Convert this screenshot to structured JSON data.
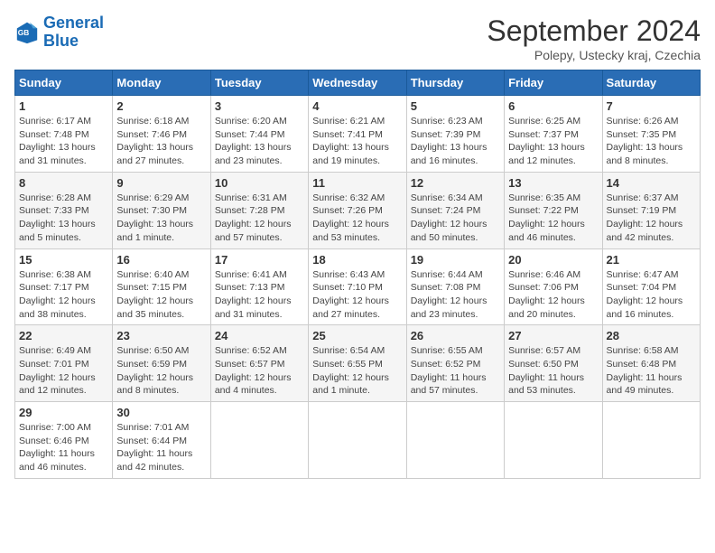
{
  "logo": {
    "line1": "General",
    "line2": "Blue"
  },
  "title": "September 2024",
  "subtitle": "Polepy, Ustecky kraj, Czechia",
  "header": {
    "days": [
      "Sunday",
      "Monday",
      "Tuesday",
      "Wednesday",
      "Thursday",
      "Friday",
      "Saturday"
    ]
  },
  "weeks": [
    [
      {
        "num": "1",
        "info": "Sunrise: 6:17 AM\nSunset: 7:48 PM\nDaylight: 13 hours\nand 31 minutes."
      },
      {
        "num": "2",
        "info": "Sunrise: 6:18 AM\nSunset: 7:46 PM\nDaylight: 13 hours\nand 27 minutes."
      },
      {
        "num": "3",
        "info": "Sunrise: 6:20 AM\nSunset: 7:44 PM\nDaylight: 13 hours\nand 23 minutes."
      },
      {
        "num": "4",
        "info": "Sunrise: 6:21 AM\nSunset: 7:41 PM\nDaylight: 13 hours\nand 19 minutes."
      },
      {
        "num": "5",
        "info": "Sunrise: 6:23 AM\nSunset: 7:39 PM\nDaylight: 13 hours\nand 16 minutes."
      },
      {
        "num": "6",
        "info": "Sunrise: 6:25 AM\nSunset: 7:37 PM\nDaylight: 13 hours\nand 12 minutes."
      },
      {
        "num": "7",
        "info": "Sunrise: 6:26 AM\nSunset: 7:35 PM\nDaylight: 13 hours\nand 8 minutes."
      }
    ],
    [
      {
        "num": "8",
        "info": "Sunrise: 6:28 AM\nSunset: 7:33 PM\nDaylight: 13 hours\nand 5 minutes."
      },
      {
        "num": "9",
        "info": "Sunrise: 6:29 AM\nSunset: 7:30 PM\nDaylight: 13 hours\nand 1 minute."
      },
      {
        "num": "10",
        "info": "Sunrise: 6:31 AM\nSunset: 7:28 PM\nDaylight: 12 hours\nand 57 minutes."
      },
      {
        "num": "11",
        "info": "Sunrise: 6:32 AM\nSunset: 7:26 PM\nDaylight: 12 hours\nand 53 minutes."
      },
      {
        "num": "12",
        "info": "Sunrise: 6:34 AM\nSunset: 7:24 PM\nDaylight: 12 hours\nand 50 minutes."
      },
      {
        "num": "13",
        "info": "Sunrise: 6:35 AM\nSunset: 7:22 PM\nDaylight: 12 hours\nand 46 minutes."
      },
      {
        "num": "14",
        "info": "Sunrise: 6:37 AM\nSunset: 7:19 PM\nDaylight: 12 hours\nand 42 minutes."
      }
    ],
    [
      {
        "num": "15",
        "info": "Sunrise: 6:38 AM\nSunset: 7:17 PM\nDaylight: 12 hours\nand 38 minutes."
      },
      {
        "num": "16",
        "info": "Sunrise: 6:40 AM\nSunset: 7:15 PM\nDaylight: 12 hours\nand 35 minutes."
      },
      {
        "num": "17",
        "info": "Sunrise: 6:41 AM\nSunset: 7:13 PM\nDaylight: 12 hours\nand 31 minutes."
      },
      {
        "num": "18",
        "info": "Sunrise: 6:43 AM\nSunset: 7:10 PM\nDaylight: 12 hours\nand 27 minutes."
      },
      {
        "num": "19",
        "info": "Sunrise: 6:44 AM\nSunset: 7:08 PM\nDaylight: 12 hours\nand 23 minutes."
      },
      {
        "num": "20",
        "info": "Sunrise: 6:46 AM\nSunset: 7:06 PM\nDaylight: 12 hours\nand 20 minutes."
      },
      {
        "num": "21",
        "info": "Sunrise: 6:47 AM\nSunset: 7:04 PM\nDaylight: 12 hours\nand 16 minutes."
      }
    ],
    [
      {
        "num": "22",
        "info": "Sunrise: 6:49 AM\nSunset: 7:01 PM\nDaylight: 12 hours\nand 12 minutes."
      },
      {
        "num": "23",
        "info": "Sunrise: 6:50 AM\nSunset: 6:59 PM\nDaylight: 12 hours\nand 8 minutes."
      },
      {
        "num": "24",
        "info": "Sunrise: 6:52 AM\nSunset: 6:57 PM\nDaylight: 12 hours\nand 4 minutes."
      },
      {
        "num": "25",
        "info": "Sunrise: 6:54 AM\nSunset: 6:55 PM\nDaylight: 12 hours\nand 1 minute."
      },
      {
        "num": "26",
        "info": "Sunrise: 6:55 AM\nSunset: 6:52 PM\nDaylight: 11 hours\nand 57 minutes."
      },
      {
        "num": "27",
        "info": "Sunrise: 6:57 AM\nSunset: 6:50 PM\nDaylight: 11 hours\nand 53 minutes."
      },
      {
        "num": "28",
        "info": "Sunrise: 6:58 AM\nSunset: 6:48 PM\nDaylight: 11 hours\nand 49 minutes."
      }
    ],
    [
      {
        "num": "29",
        "info": "Sunrise: 7:00 AM\nSunset: 6:46 PM\nDaylight: 11 hours\nand 46 minutes."
      },
      {
        "num": "30",
        "info": "Sunrise: 7:01 AM\nSunset: 6:44 PM\nDaylight: 11 hours\nand 42 minutes."
      },
      {
        "num": "",
        "info": ""
      },
      {
        "num": "",
        "info": ""
      },
      {
        "num": "",
        "info": ""
      },
      {
        "num": "",
        "info": ""
      },
      {
        "num": "",
        "info": ""
      }
    ]
  ]
}
